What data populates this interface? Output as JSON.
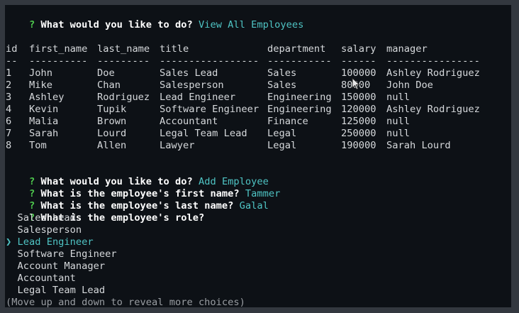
{
  "prompts": {
    "q_marker": "?",
    "action1": {
      "question": "What would you like to do?",
      "answer": "View All Employees"
    },
    "action2": {
      "question": "What would you like to do?",
      "answer": "Add Employee"
    },
    "first_name": {
      "question": "What is the employee's first name?",
      "answer": "Tammer"
    },
    "last_name": {
      "question": "What is the employee's last name?",
      "answer": "Galal"
    },
    "role": {
      "question": "What is the employee's role?"
    }
  },
  "table": {
    "headers": [
      "id",
      "first_name",
      "last_name",
      "title",
      "department",
      "salary",
      "manager"
    ],
    "dashes": [
      "--",
      "----------",
      "---------",
      "-----------------",
      "-----------",
      "------",
      "----------------"
    ],
    "rows": [
      [
        "1",
        "John",
        "Doe",
        "Sales Lead",
        "Sales",
        "100000",
        "Ashley Rodriguez"
      ],
      [
        "2",
        "Mike",
        "Chan",
        "Salesperson",
        "Sales",
        "80000",
        "John Doe"
      ],
      [
        "3",
        "Ashley",
        "Rodriguez",
        "Lead Engineer",
        "Engineering",
        "150000",
        "null"
      ],
      [
        "4",
        "Kevin",
        "Tupik",
        "Software Engineer",
        "Engineering",
        "120000",
        "Ashley Rodriguez"
      ],
      [
        "6",
        "Malia",
        "Brown",
        "Accountant",
        "Finance",
        "125000",
        "null"
      ],
      [
        "7",
        "Sarah",
        "Lourd",
        "Legal Team Lead",
        "Legal",
        "250000",
        "null"
      ],
      [
        "8",
        "Tom",
        "Allen",
        "Lawyer",
        "Legal",
        "190000",
        "Sarah Lourd"
      ]
    ]
  },
  "choices": {
    "pointer": "❯",
    "items": [
      "Sales Lead",
      "Salesperson",
      "Lead Engineer",
      "Software Engineer",
      "Account Manager",
      "Accountant",
      "Legal Team Lead"
    ],
    "selected_index": 2,
    "hint": "(Move up and down to reveal more choices)"
  },
  "colors": {
    "question_marker": "#4ec94e",
    "answer": "#4fc4c4",
    "background": "#0d1116"
  },
  "icons": {
    "cursor": "text-cursor-icon"
  }
}
